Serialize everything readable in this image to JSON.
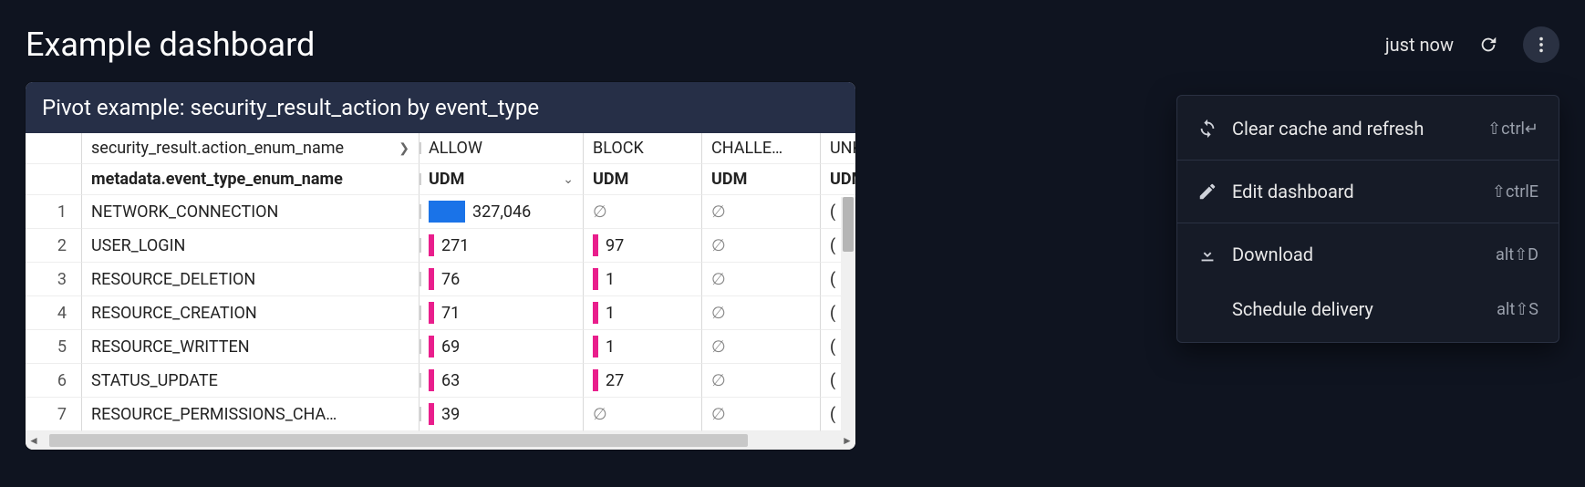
{
  "header": {
    "title": "Example dashboard",
    "status": "just now",
    "refresh_icon": "refresh",
    "more_icon": "more-vert"
  },
  "panel": {
    "title": "Pivot example: security_result_action by event_type",
    "pivot_field_label": "security_result.action_enum_name",
    "row_field_label": "metadata.event_type_enum_name",
    "measure_label": "UDM",
    "columns": [
      "ALLOW",
      "BLOCK",
      "CHALLE…",
      "UNK"
    ],
    "rows": [
      {
        "n": 1,
        "name": "NETWORK_CONNECTION",
        "allow": "327,046",
        "allow_bar": 40,
        "allow_blue": true,
        "block": "∅",
        "block_bar": 0,
        "chal": "∅",
        "unk": "("
      },
      {
        "n": 2,
        "name": "USER_LOGIN",
        "allow": "271",
        "allow_bar": 6,
        "allow_blue": false,
        "block": "97",
        "block_bar": 6,
        "chal": "∅",
        "unk": "("
      },
      {
        "n": 3,
        "name": "RESOURCE_DELETION",
        "allow": "76",
        "allow_bar": 6,
        "allow_blue": false,
        "block": "1",
        "block_bar": 6,
        "chal": "∅",
        "unk": "("
      },
      {
        "n": 4,
        "name": "RESOURCE_CREATION",
        "allow": "71",
        "allow_bar": 6,
        "allow_blue": false,
        "block": "1",
        "block_bar": 6,
        "chal": "∅",
        "unk": "("
      },
      {
        "n": 5,
        "name": "RESOURCE_WRITTEN",
        "allow": "69",
        "allow_bar": 6,
        "allow_blue": false,
        "block": "1",
        "block_bar": 6,
        "chal": "∅",
        "unk": "("
      },
      {
        "n": 6,
        "name": "STATUS_UPDATE",
        "allow": "63",
        "allow_bar": 6,
        "allow_blue": false,
        "block": "27",
        "block_bar": 6,
        "chal": "∅",
        "unk": "("
      },
      {
        "n": 7,
        "name": "RESOURCE_PERMISSIONS_CHA…",
        "allow": "39",
        "allow_bar": 6,
        "allow_blue": false,
        "block": "∅",
        "block_bar": 0,
        "chal": "∅",
        "unk": "("
      }
    ]
  },
  "menu": {
    "items": [
      {
        "id": "clear-cache",
        "icon": "sync",
        "label": "Clear cache and refresh",
        "shortcut": "⇧ctrl↵"
      },
      {
        "id": "edit",
        "icon": "pencil",
        "label": "Edit dashboard",
        "shortcut": "⇧ctrlE"
      },
      {
        "id": "download",
        "icon": "download",
        "label": "Download",
        "shortcut": "alt⇧D"
      },
      {
        "id": "schedule",
        "icon": "",
        "label": "Schedule delivery",
        "shortcut": "alt⇧S"
      }
    ]
  }
}
